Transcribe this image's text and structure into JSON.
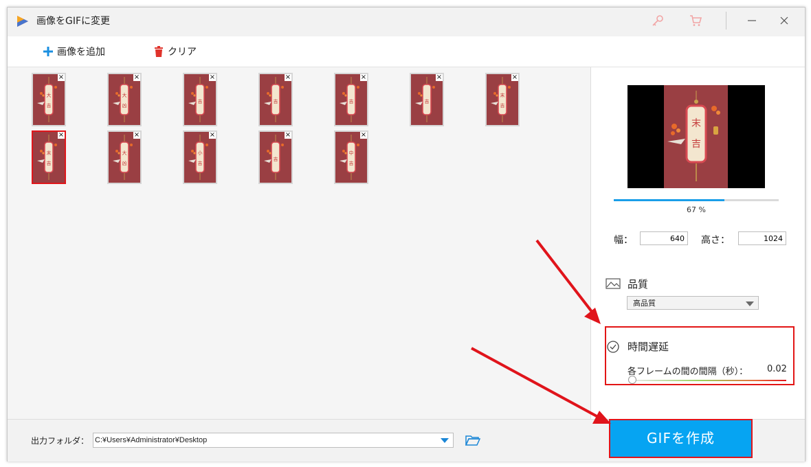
{
  "window": {
    "title": "画像をGIFに変更"
  },
  "toolbar": {
    "add_label": "画像を追加",
    "clear_label": "クリア"
  },
  "thumbnails": [
    {
      "chars": "大吉",
      "selected": false
    },
    {
      "chars": "大凶",
      "selected": false
    },
    {
      "chars": "吉",
      "selected": false
    },
    {
      "chars": "吉",
      "selected": false
    },
    {
      "chars": "吉",
      "selected": false
    },
    {
      "chars": "吉",
      "selected": false
    },
    {
      "chars": "末吉",
      "selected": false
    },
    {
      "chars": "末吉",
      "selected": true
    },
    {
      "chars": "大凶",
      "selected": false
    },
    {
      "chars": "小吉",
      "selected": false
    },
    {
      "chars": "吉",
      "selected": false
    },
    {
      "chars": "中吉",
      "selected": false
    }
  ],
  "preview": {
    "chars": "末吉",
    "progress_percent": 67,
    "progress_text": "67 %"
  },
  "size": {
    "width_label": "幅：",
    "width_value": "640",
    "height_label": "高さ：",
    "height_value": "1024"
  },
  "quality": {
    "title": "品質",
    "selected": "高品質"
  },
  "delay": {
    "title": "時間遅延",
    "label": "各フレームの間の間隔（秒）：",
    "value": "0.02",
    "slider_fraction": 0
  },
  "footer": {
    "output_label": "出力フォルダ：",
    "output_path": "C:¥Users¥Administrator¥Desktop",
    "create_label": "GIFを作成"
  },
  "colors": {
    "accent": "#06a4f2",
    "highlight": "#e0141b",
    "card": "#9a3f43"
  },
  "icons": [
    "app-logo-icon",
    "key-icon",
    "cart-icon",
    "minimize-icon",
    "close-icon",
    "plus-icon",
    "trash-icon",
    "image-icon",
    "clock-icon",
    "folder-icon",
    "chevron-down-icon"
  ]
}
